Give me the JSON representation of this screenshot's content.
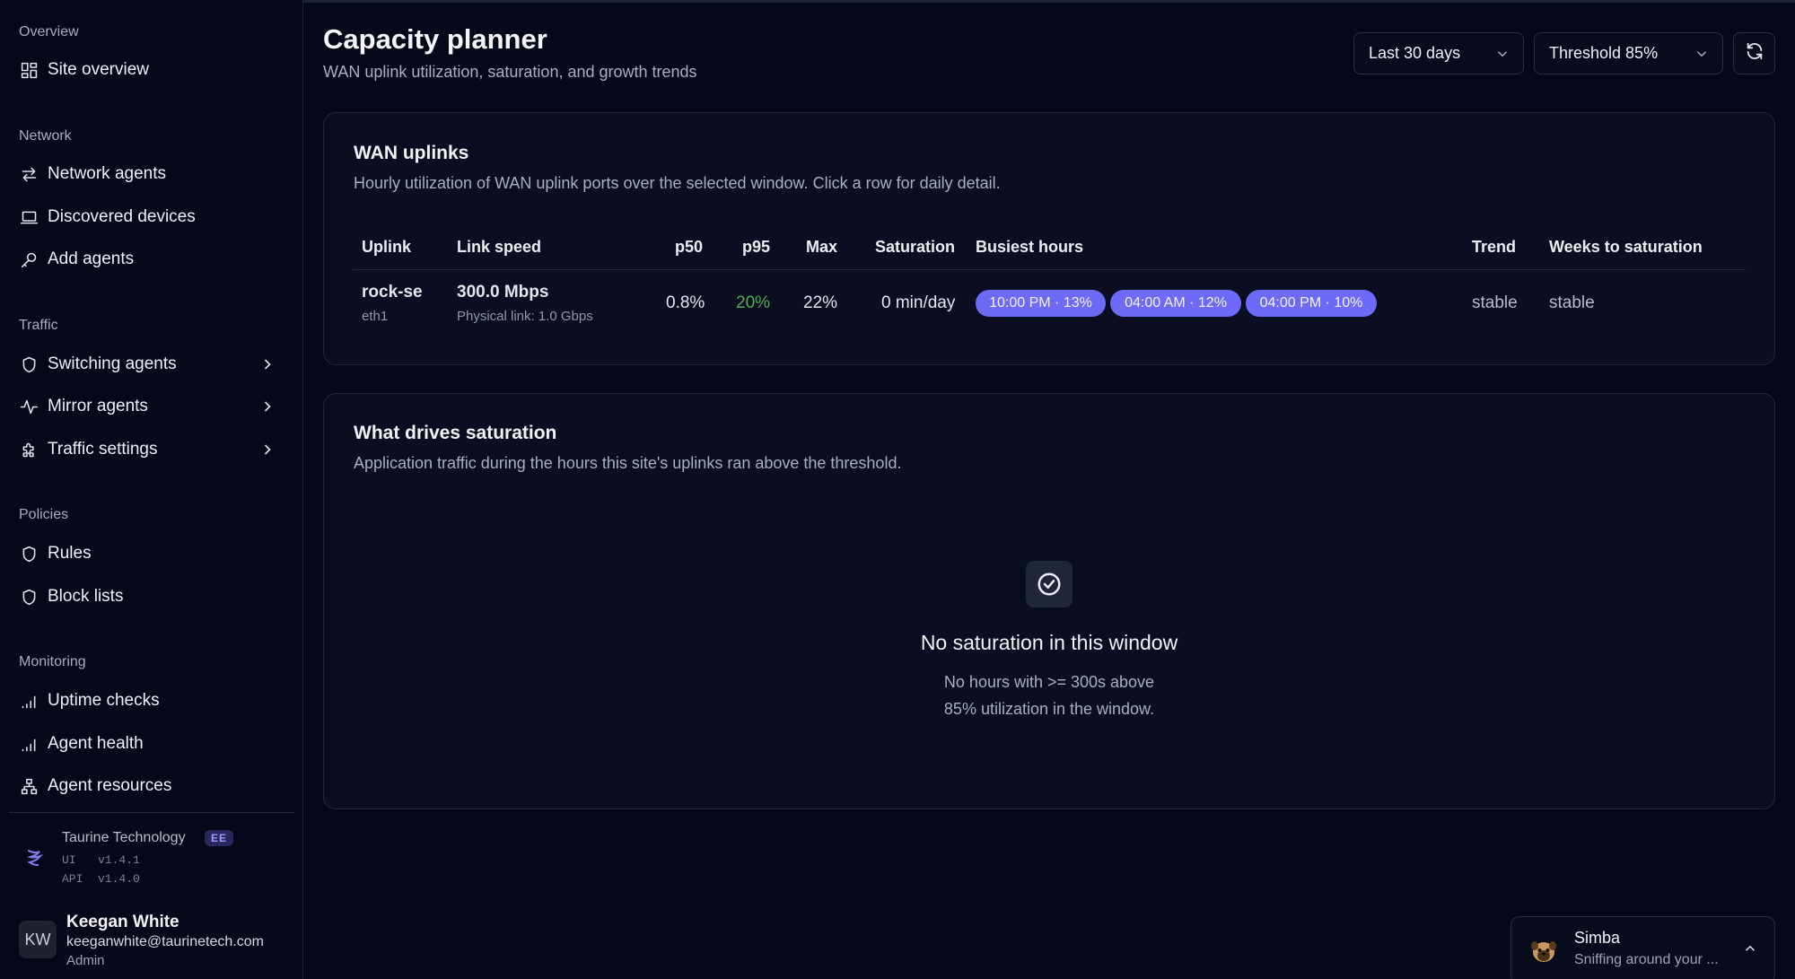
{
  "sidebar": {
    "groups": [
      {
        "title": "Overview"
      },
      {
        "title": "Network"
      },
      {
        "title": "Traffic"
      },
      {
        "title": "Policies"
      },
      {
        "title": "Monitoring"
      }
    ],
    "items": [
      {
        "label": "Site overview",
        "icon": "dashboard-grid-icon"
      },
      {
        "label": "Network agents",
        "icon": "arrows-swap-icon"
      },
      {
        "label": "Discovered devices",
        "icon": "laptop-icon"
      },
      {
        "label": "Add agents",
        "icon": "key-icon"
      },
      {
        "label": "Switching agents",
        "icon": "shield-icon"
      },
      {
        "label": "Mirror agents",
        "icon": "activity-icon"
      },
      {
        "label": "Traffic settings",
        "icon": "puzzle-icon"
      },
      {
        "label": "Rules",
        "icon": "shield-icon"
      },
      {
        "label": "Block lists",
        "icon": "shield-icon"
      },
      {
        "label": "Uptime checks",
        "icon": "signal-bars-icon"
      },
      {
        "label": "Agent health",
        "icon": "signal-bars-icon"
      },
      {
        "label": "Agent resources",
        "icon": "network-tree-icon"
      }
    ],
    "org": {
      "name": "Taurine Technology",
      "edition": "EE",
      "ui_label": "UI",
      "ui_version": "v1.4.1",
      "api_label": "API",
      "api_version": "v1.4.0"
    },
    "user": {
      "initials": "KW",
      "name": "Keegan White",
      "email": "keeganwhite@taurinetech.com",
      "role": "Admin"
    }
  },
  "header": {
    "title": "Capacity planner",
    "subtitle": "WAN uplink utilization, saturation, and growth trends",
    "range_select": "Last 30 days",
    "threshold_select": "Threshold 85%"
  },
  "wan_card": {
    "title": "WAN uplinks",
    "subtitle": "Hourly utilization of WAN uplink ports over the selected window. Click a row for daily detail.",
    "columns": [
      "Uplink",
      "Link speed",
      "p50",
      "p95",
      "Max",
      "Saturation",
      "Busiest hours",
      "Trend",
      "Weeks to saturation"
    ],
    "rows": [
      {
        "uplink": "rock-se",
        "port": "eth1",
        "speed": "300.0 Mbps",
        "physical": "Physical link: 1.0 Gbps",
        "p50": "0.8%",
        "p95": "20%",
        "max": "22%",
        "saturation": "0 min/day",
        "busiest": [
          "10:00 PM · 13%",
          "04:00 AM · 12%",
          "04:00 PM · 10%"
        ],
        "trend": "stable",
        "weeks": "stable"
      }
    ]
  },
  "drivers_card": {
    "title": "What drives saturation",
    "subtitle": "Application traffic during the hours this site's uplinks ran above the threshold.",
    "empty_title": "No saturation in this window",
    "empty_line1": "No hours with >= 300s above",
    "empty_line2": "85% utilization in the window."
  },
  "assistant": {
    "name": "Simba",
    "status": "Sniffing around your ..."
  },
  "colors": {
    "background": "#050818",
    "card": "#0a0e20",
    "accent_pill": "#6d6af7",
    "p95_green": "#4caf50",
    "ee_badge": "#2a2660"
  }
}
